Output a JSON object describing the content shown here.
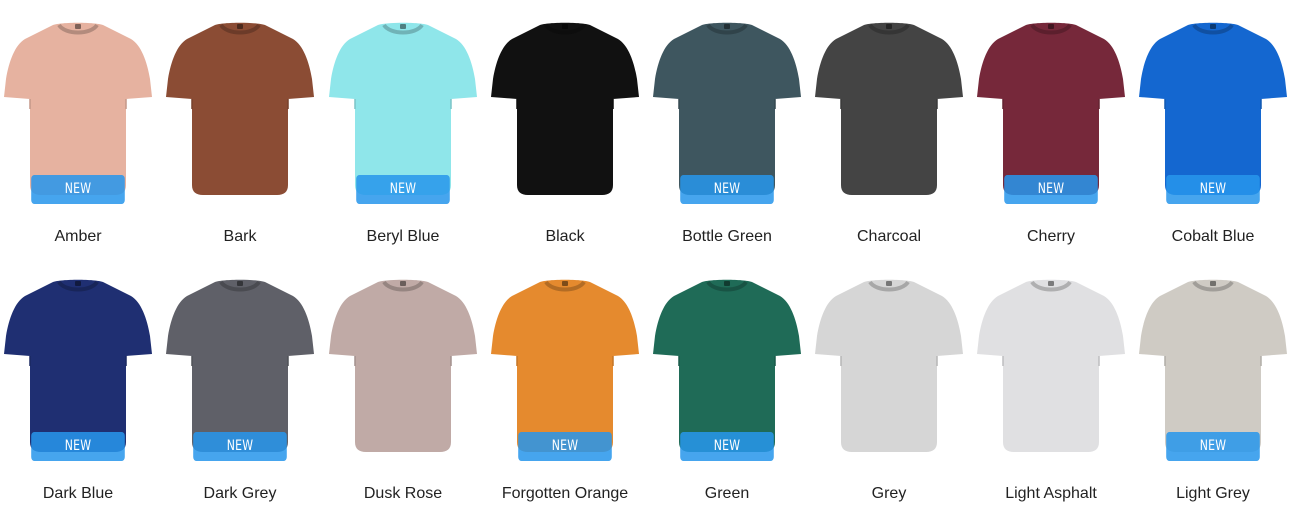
{
  "badge_text": "NEW",
  "colors": [
    {
      "label": "Amber",
      "hex": "#e6b2a0",
      "new": true
    },
    {
      "label": "Bark",
      "hex": "#8b4c34",
      "new": false
    },
    {
      "label": "Beryl Blue",
      "hex": "#8fe6ea",
      "new": true
    },
    {
      "label": "Black",
      "hex": "#111111",
      "new": false
    },
    {
      "label": "Bottle Green",
      "hex": "#3e565f",
      "new": true
    },
    {
      "label": "Charcoal",
      "hex": "#444444",
      "new": false
    },
    {
      "label": "Cherry",
      "hex": "#76283a",
      "new": true
    },
    {
      "label": "Cobalt Blue",
      "hex": "#1467d0",
      "new": true
    },
    {
      "label": "Dark Blue",
      "hex": "#1f2f72",
      "new": true
    },
    {
      "label": "Dark Grey",
      "hex": "#5f6068",
      "new": true
    },
    {
      "label": "Dusk Rose",
      "hex": "#c0aaa6",
      "new": false
    },
    {
      "label": "Forgotten Orange",
      "hex": "#e58a2e",
      "new": true
    },
    {
      "label": "Green",
      "hex": "#1f6b57",
      "new": true
    },
    {
      "label": "Grey",
      "hex": "#d6d6d6",
      "new": false
    },
    {
      "label": "Light Asphalt",
      "hex": "#e0e0e2",
      "new": false
    },
    {
      "label": "Light Grey",
      "hex": "#cfcbc4",
      "new": true
    }
  ]
}
